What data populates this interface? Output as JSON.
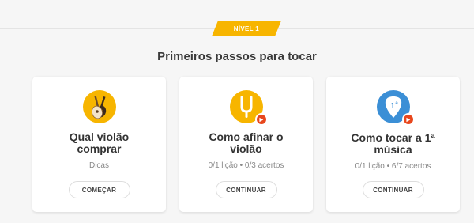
{
  "level_badge": "NÍVEL 1",
  "section_title": "Primeiros passos para tocar",
  "colors": {
    "accent_yellow": "#f7b500",
    "play_red": "#e8471d",
    "pick_blue": "#3b8fd6"
  },
  "cards": [
    {
      "icon": "guitars-icon",
      "title": "Qual violão comprar",
      "subtitle": "Dicas",
      "button": "COMEÇAR",
      "has_play_badge": false
    },
    {
      "icon": "tuning-fork-icon",
      "title": "Como afinar o violão",
      "subtitle": "0/1 lição • 0/3 acertos",
      "button": "CONTINUAR",
      "has_play_badge": true
    },
    {
      "icon": "guitar-pick-icon",
      "title": "Como tocar a 1ª música",
      "subtitle": "0/1 lição • 6/7 acertos",
      "button": "CONTINUAR",
      "has_play_badge": true
    }
  ]
}
